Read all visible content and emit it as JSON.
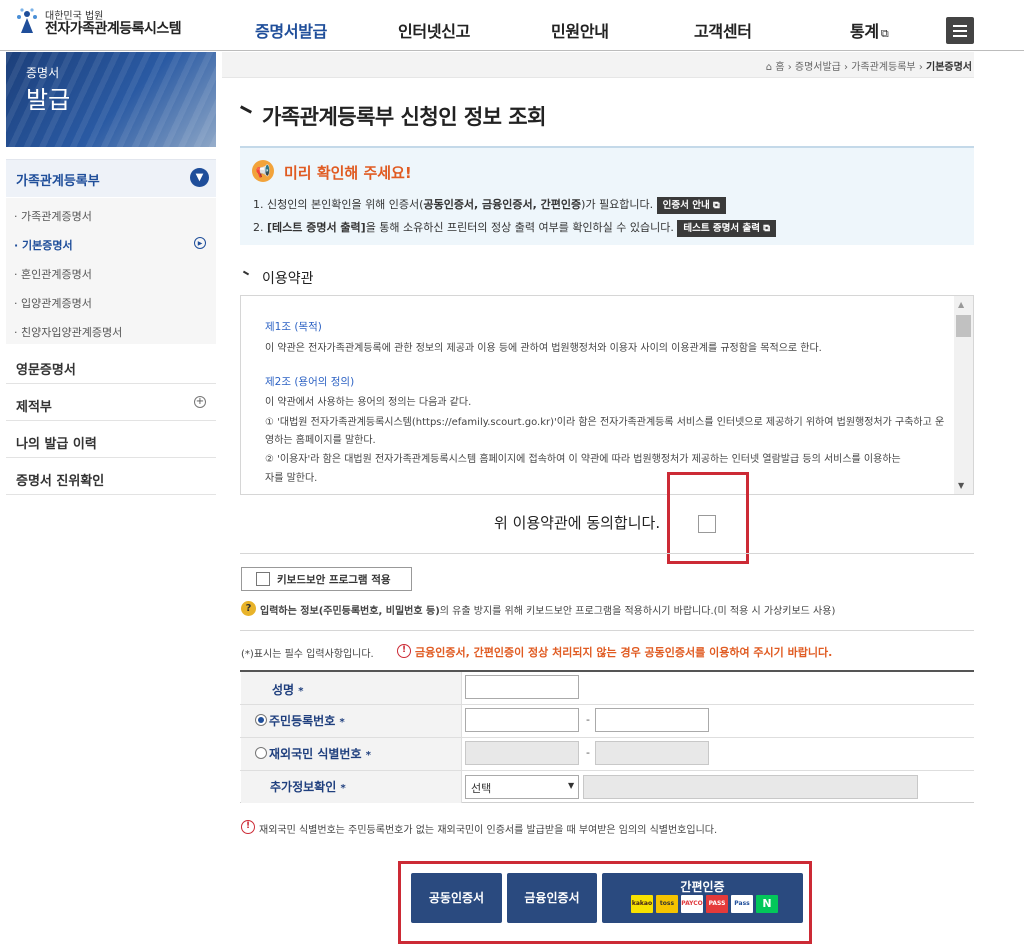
{
  "header": {
    "org": "대한민국 법원",
    "title": "전자가족관계등록시스템",
    "nav": [
      "증명서발급",
      "인터넷신고",
      "민원안내",
      "고객센터",
      "통계"
    ]
  },
  "sidebar": {
    "banner_line1": "증명서",
    "banner_line2": "발급",
    "section": "가족관계등록부",
    "subitems": [
      "가족관계증명서",
      "기본증명서",
      "혼인관계증명서",
      "입양관계증명서",
      "친양자입양관계증명서"
    ],
    "items": [
      "영문증명서",
      "제적부",
      "나의 발급 이력",
      "증명서 진위확인"
    ]
  },
  "breadcrumb": {
    "home": "홈",
    "path": [
      "증명서발급",
      "가족관계등록부"
    ],
    "current": "기본증명서"
  },
  "page": {
    "title": "가족관계등록부 신청인 정보 조회"
  },
  "notice": {
    "title": "미리 확인해 주세요!",
    "line1_a": "1. 신청인의 본인확인을 위해 인증서(",
    "line1_b": "공동인증서, 금융인증서, 간편인증",
    "line1_c": ")가 필요합니다.",
    "cert_button": "인증서 안내",
    "line2_a": "2. ",
    "line2_b": "[테스트 증명서 출력]",
    "line2_c": "을 통해 소유하신 프린터의 정상 출력 여부를 확인하실 수 있습니다.",
    "test_button": "테스트 증명서 출력"
  },
  "terms": {
    "section_title": "이용약관",
    "art1_title": "제1조 (목적)",
    "art1_text": "이 약관은 전자가족관계등록에 관한 정보의 제공과 이용 등에 관하여 법원행정처와 이용자 사이의 이용관계를 규정함을 목적으로 한다.",
    "art2_title": "제2조 (용어의 정의)",
    "art2_text": "이 약관에서 사용하는 용어의 정의는 다음과 같다.",
    "art2_item1_a": "① '대법원 전자가족관계등록시스템(https://efamily.scourt.go.kr)'이라 함은 전자가족관계등록 서비스를 인터넷으로 제공하기 위하여 법원행정처가 구축하고 운",
    "art2_item1_b": "영하는 홈페이지를 말한다.",
    "art2_item2_a": "② '이용자'라 함은 대법원 전자가족관계등록시스템 홈페이지에 접속하여 이 약관에 따라 법원행정처가 제공하는 인터넷 열람발급 등의 서비스를 이용하는",
    "art2_item2_b": "자를 말한다.",
    "agree_label": "위 이용약관에 동의합니다."
  },
  "keyboard": {
    "button_label": "키보드보안 프로그램 적용",
    "desc_a": "입력하는 정보",
    "desc_b": "(주민등록번호, 비밀번호 등)",
    "desc_c": "의 유출 방지를 위해 키보드보안 프로그램을 적용하시기 바랍니다.(미 적용 시 가상키보드 사용)"
  },
  "form": {
    "required_note": "(*)표시는 필수 입력사항입니다.",
    "warning": "금융인증서, 간편인증이 정상 처리되지 않는 경우 공동인증서를 이용하여 주시기 바랍니다.",
    "name_label": "성명",
    "rrn_label": "주민등록번호",
    "foreign_label": "재외국민 식별번호",
    "extra_label": "추가정보확인",
    "required_mark": "*",
    "dash": "-",
    "extra_select": "선택",
    "rrn_selected": true
  },
  "footer_note": "재외국민 식별번호는 주민등록번호가 없는 재외국민이 인증서를 발급받을 때 부여받은 임의의 식별번호입니다.",
  "auth": {
    "joint_cert": "공동인증서",
    "financial_cert": "금융인증서",
    "simple_auth": "간편인증",
    "providers": [
      "kakao",
      "toss",
      "PAYCO",
      "PASS",
      "Pass",
      "N"
    ]
  },
  "colors": {
    "brand_navy": "#1f4e9a",
    "auth_button": "#2a4a7f",
    "highlight_red": "#cc2a35",
    "notice_orange": "#e05b22"
  }
}
